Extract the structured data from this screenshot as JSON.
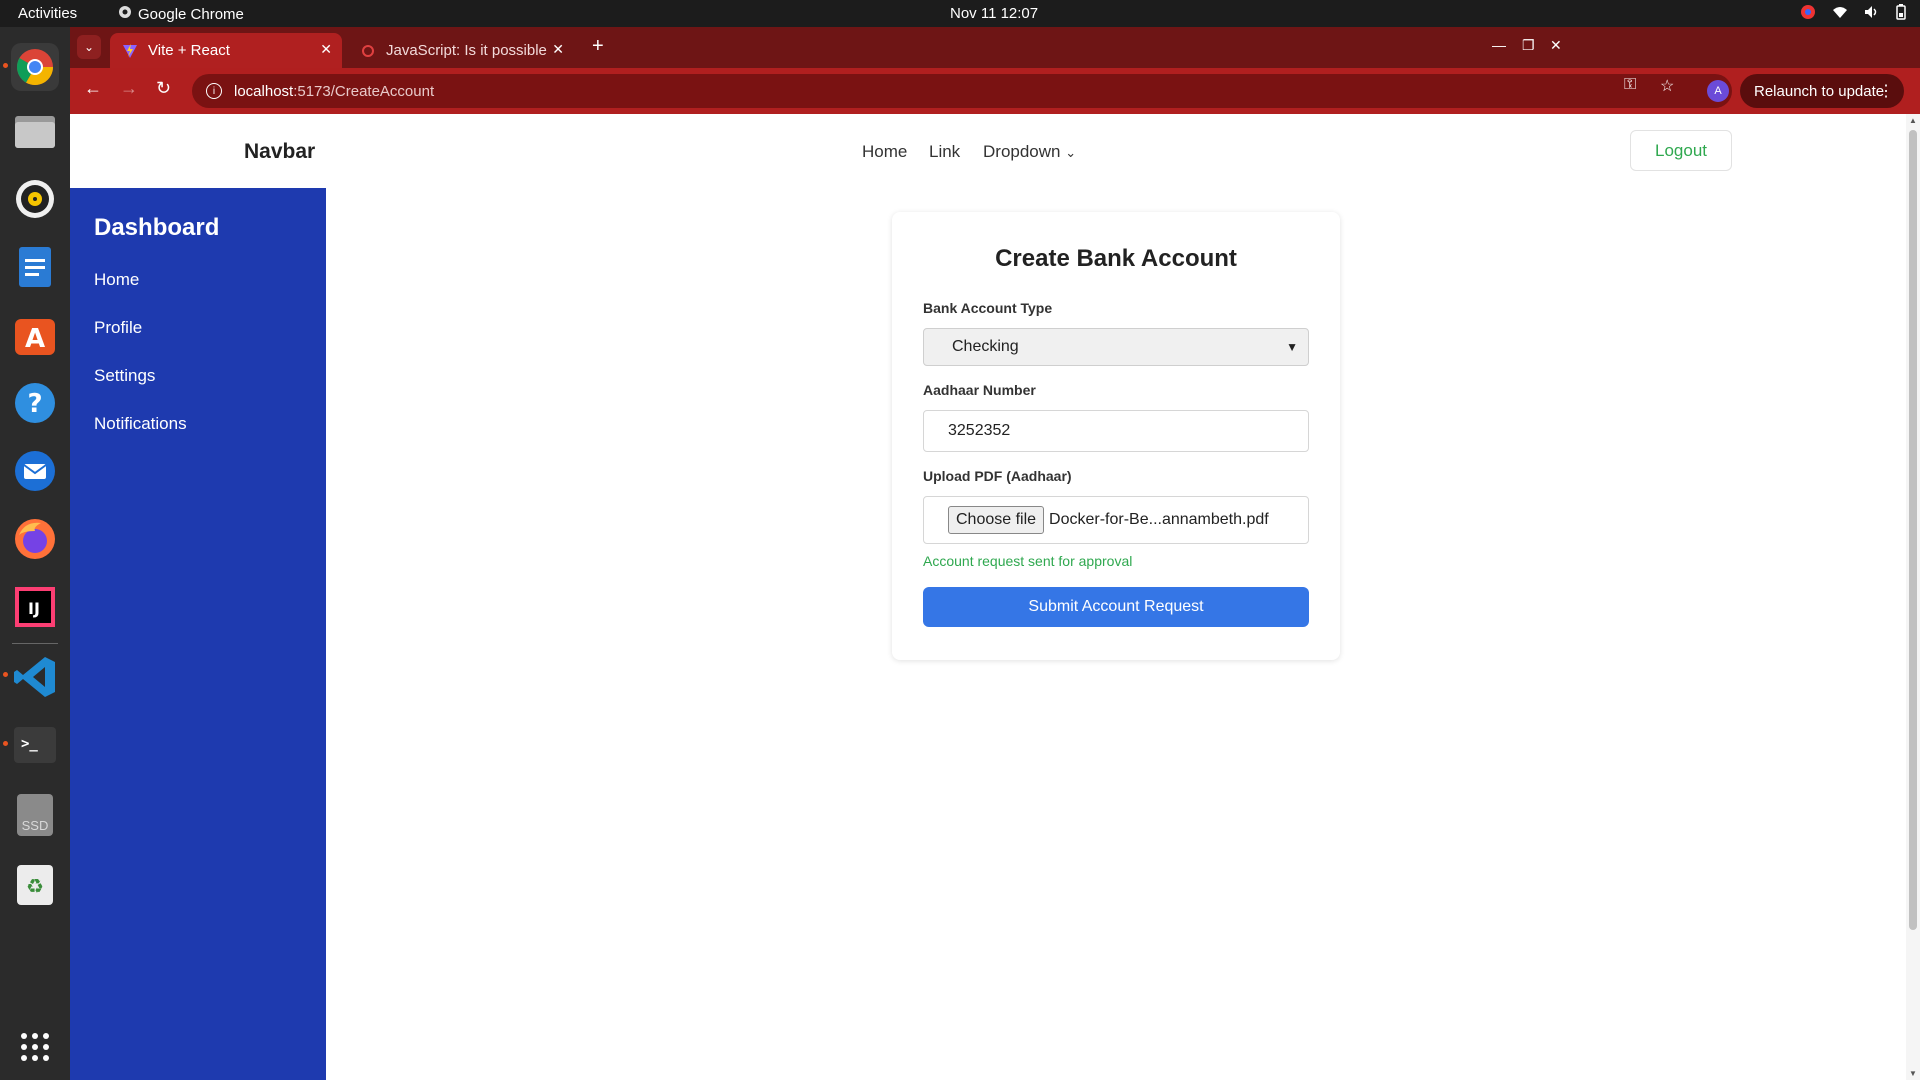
{
  "system": {
    "activities": "Activities",
    "app_name": "Google Chrome",
    "datetime": "Nov 11  12:07"
  },
  "dock": {
    "items": [
      "chrome-icon",
      "files-icon",
      "rhythmbox-icon",
      "writer-icon",
      "app-center-icon",
      "help-icon",
      "thunderbird-icon",
      "firefox-icon",
      "intellij-icon",
      "vscode-icon",
      "terminal-icon",
      "ssd-drive-icon",
      "trash-icon",
      "app-grid-icon"
    ],
    "ssd_label": "SSD"
  },
  "browser": {
    "tabs": [
      {
        "title": "Vite + React",
        "active": true
      },
      {
        "title": "JavaScript: Is it possible",
        "active": false
      }
    ],
    "url_host": "localhost",
    "url_path": ":5173/CreateAccount",
    "profile_initial": "A",
    "relaunch_label": "Relaunch to update",
    "theme_color": "#b01f1f"
  },
  "navbar": {
    "brand": "Navbar",
    "links": [
      "Home",
      "Link",
      "Dropdown"
    ],
    "logout": "Logout"
  },
  "sidebar": {
    "title": "Dashboard",
    "items": [
      "Home",
      "Profile",
      "Settings",
      "Notifications"
    ],
    "color": "#1e3aaf"
  },
  "form": {
    "title": "Create Bank Account",
    "account_type_label": "Bank Account Type",
    "account_type_value": "Checking",
    "aadhaar_label": "Aadhaar Number",
    "aadhaar_value": "3252352",
    "upload_label": "Upload PDF (Aadhaar)",
    "choose_file": "Choose file",
    "file_name": "Docker-for-Be...annambeth.pdf",
    "status_message": "Account request sent for approval",
    "submit_label": "Submit Account Request",
    "accent_color": "#3576e6",
    "success_color": "#2fa84f"
  }
}
